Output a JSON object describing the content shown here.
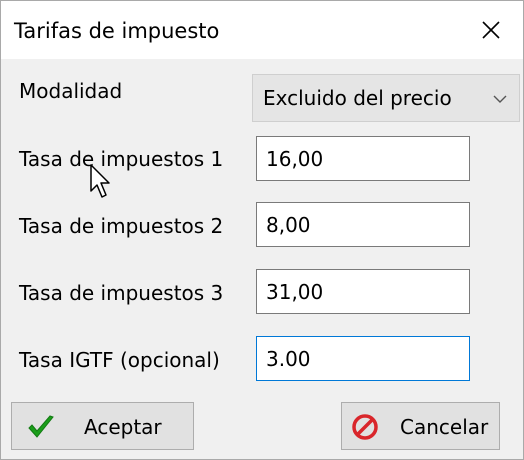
{
  "window": {
    "title": "Tarifas de impuesto"
  },
  "icons": {
    "close": "close-icon",
    "dropdown": "chevron-down-icon",
    "accept": "checkmark-icon",
    "cancel": "cancel-prohibited-icon",
    "cursor": "mouse-cursor-icon"
  },
  "form": {
    "modalidad": {
      "label": "Modalidad",
      "selected": "Excluido del precio"
    },
    "rate1": {
      "label": "Tasa de impuestos 1",
      "value": "16,00"
    },
    "rate2": {
      "label": "Tasa de impuestos 2",
      "value": "8,00"
    },
    "rate3": {
      "label": "Tasa de impuestos 3",
      "value": "31,00"
    },
    "igtf": {
      "label": "Tasa IGTF (opcional)",
      "value": "3.00"
    }
  },
  "buttons": {
    "accept_label": "Aceptar",
    "cancel_label": "Cancelar"
  },
  "colors": {
    "accept_icon": "#1a9e1a",
    "cancel_icon": "#d9262b",
    "focus_border": "#0078d7"
  }
}
